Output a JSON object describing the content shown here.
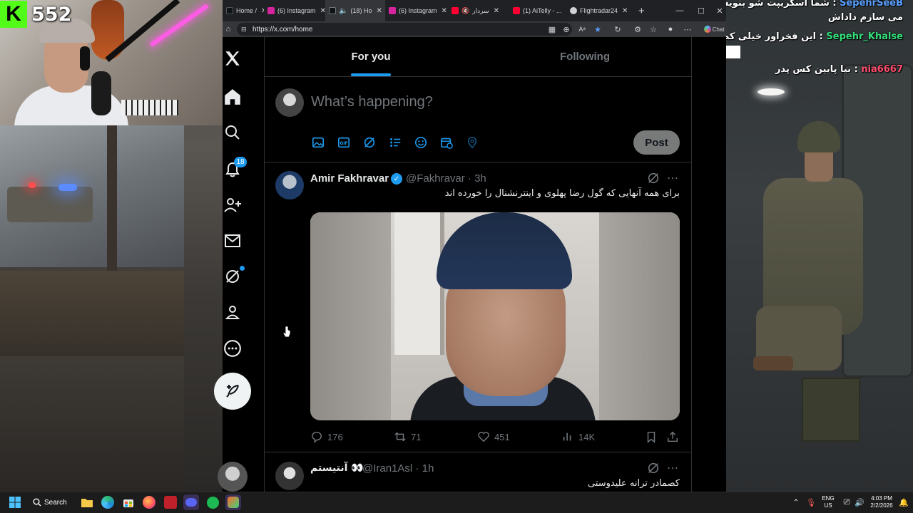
{
  "stream": {
    "kick_count": "552",
    "kick_logo_letter": "K"
  },
  "chat": [
    {
      "user": "SepehrSeeB",
      "message": "شما اسکریپت شو بنویس خودم"
    },
    {
      "user": "",
      "message": "می سازم داداش"
    },
    {
      "user": "Sepehr_Khalse",
      "message": "این فخراور خیلی کصخله"
    },
    {
      "user": "nia6667",
      "message": "بیا پایین کس پدر"
    }
  ],
  "browser": {
    "tabs": [
      {
        "label": "Home /",
        "icon_color": "#0f1419"
      },
      {
        "label": "(6) Instagram",
        "icon_color": "#d6249f"
      },
      {
        "label": "(18) Ho",
        "icon_color": "#0f1419",
        "active": true
      },
      {
        "label": "(6) Instagram",
        "icon_color": "#d6249f"
      },
      {
        "label": "سردار",
        "icon_color": "#ff0033"
      },
      {
        "label": "(1) ...",
        "icon_color": "#ff0033"
      },
      {
        "label": "(1) AiTelly - ...",
        "icon_color": "#ff0033"
      },
      {
        "label": "Flightradar24",
        "icon_color": "#cfd2d6"
      }
    ],
    "new_tab_label": "+",
    "url": "https://x.com/home",
    "chat_button_label": "Chat"
  },
  "x": {
    "notifications_count": "18",
    "tabs": [
      {
        "label": "For you",
        "active": true
      },
      {
        "label": "Following",
        "active": false
      }
    ],
    "composer": {
      "placeholder": "What’s happening?",
      "post_label": "Post"
    },
    "tweets": [
      {
        "name": "Amir Fakhravar",
        "handle": "@Fakhravar",
        "time": "3h",
        "text": "برای همه آنهایی که گول رضا پهلوی و اینترنشنال را خورده اند",
        "replies": "176",
        "reposts": "71",
        "likes": "451",
        "views": "14K",
        "verified": true
      },
      {
        "name": "آنتیستم 👀",
        "handle": "@Iran1Asl",
        "time": "1h",
        "text": "کصمادر ترانه علیدوستی"
      }
    ]
  },
  "taskbar": {
    "search_label": "Search",
    "lang_line1": "ENG",
    "lang_line2": "US",
    "time": "4:03 PM",
    "date": "2/2/2026"
  },
  "colors": {
    "x_blue": "#1d9bf0",
    "kick_green": "#53fc18",
    "chat_user_green": "#34e07a",
    "chat_user_red": "#ff4d6d"
  }
}
